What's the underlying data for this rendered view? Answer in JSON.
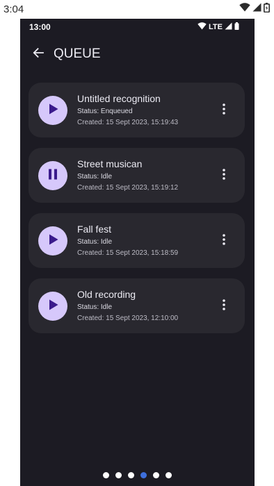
{
  "outer_status_bar": {
    "time": "3:04",
    "icons": [
      "wifi-icon",
      "signal-icon",
      "battery-icon"
    ]
  },
  "status_bar": {
    "time": "13:00",
    "network": "LTE",
    "icons": [
      "wifi-icon",
      "signal-icon",
      "battery-icon"
    ]
  },
  "header": {
    "back_icon": "arrow-back-icon",
    "title": "QUEUE"
  },
  "queue": [
    {
      "title": "Untitled recognition",
      "status": "Status: Enqueued",
      "created": "Created: 15 Sept 2023, 15:19:43",
      "action_icon": "play-icon"
    },
    {
      "title": "Street musican",
      "status": "Status: Idle",
      "created": "Created: 15 Sept 2023, 15:19:12",
      "action_icon": "pause-icon"
    },
    {
      "title": "Fall fest",
      "status": "Status: Idle",
      "created": "Created: 15 Sept 2023, 15:18:59",
      "action_icon": "play-icon"
    },
    {
      "title": "Old recording",
      "status": "Status: Idle",
      "created": "Created: 15 Sept 2023, 12:10:00",
      "action_icon": "play-icon"
    }
  ],
  "pager": {
    "count": 6,
    "active_index": 3
  },
  "colors": {
    "background": "#1c1b23",
    "card": "#29282f",
    "accent": "#d6c8fb",
    "accent_icon": "#3a1a8c",
    "active_dot": "#3d6fdc"
  }
}
